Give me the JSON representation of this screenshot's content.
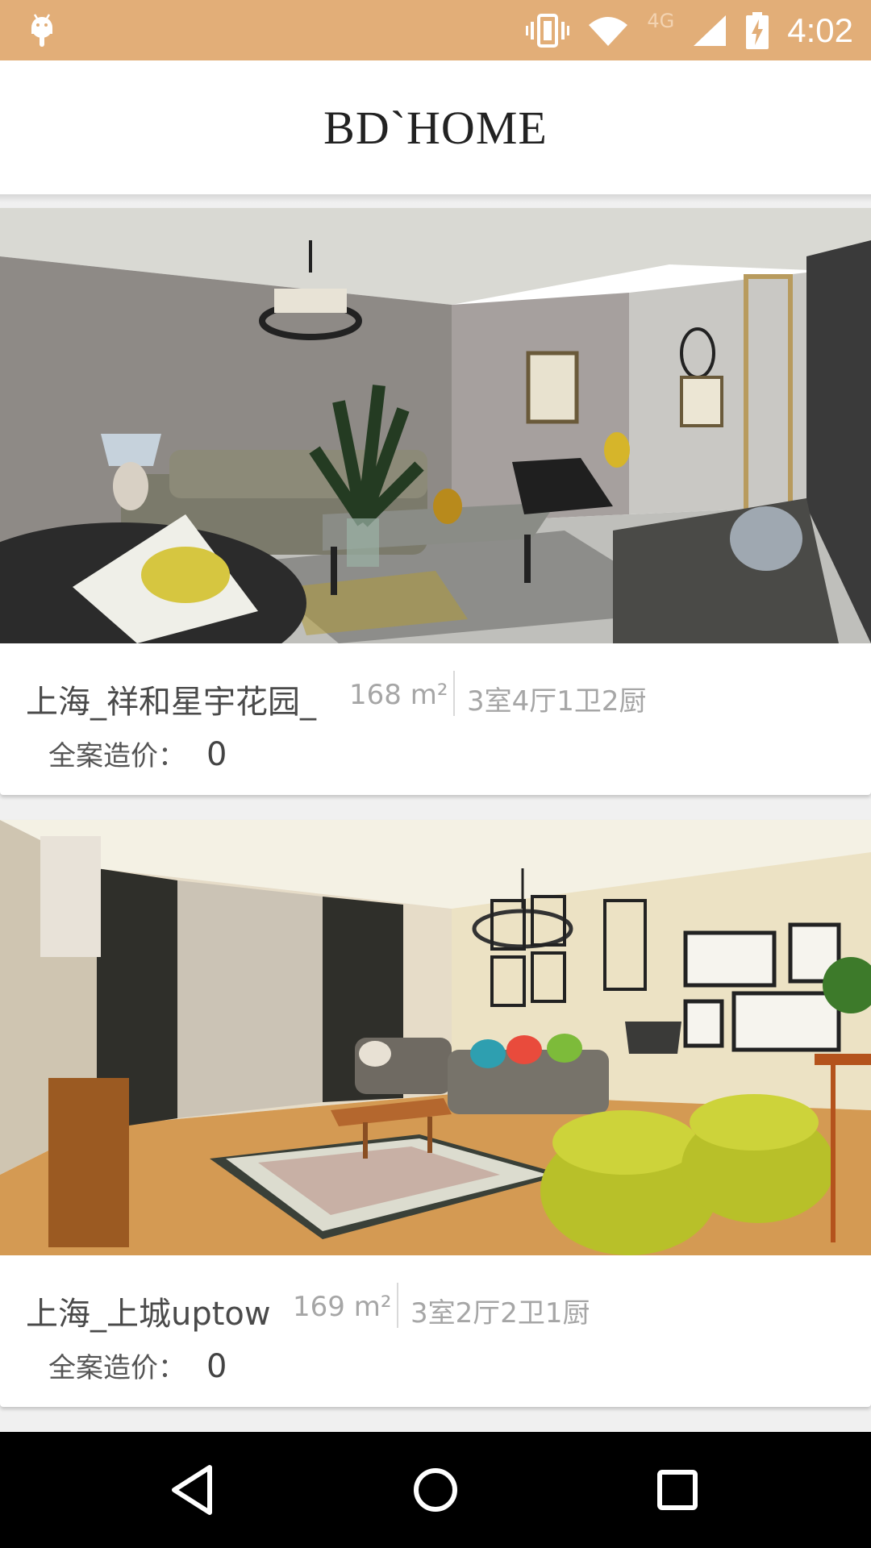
{
  "status_bar": {
    "time": "4:02",
    "network": "4G",
    "icons": [
      "android-icon",
      "vibrate-icon",
      "wifi-icon",
      "signal-icon",
      "battery-charging-icon"
    ],
    "background": "#e2ae78"
  },
  "header": {
    "title": "BD`HOME"
  },
  "listings": [
    {
      "title": "上海_祥和星宇花园_",
      "area": "168 m²",
      "layout": "3室4厅1卫2厨",
      "price_label": "全案造价：",
      "price_value": "0",
      "image": "living-room-gray-walls-photo"
    },
    {
      "title": "上海_上城uptow",
      "area": "169 m²",
      "layout": "3室2厅2卫1厨",
      "price_label": "全案造价：",
      "price_value": "0",
      "image": "living-room-yellow-chairs-photo"
    }
  ],
  "nav_bar": {
    "icons": [
      "back-icon",
      "home-icon",
      "recent-apps-icon"
    ]
  }
}
